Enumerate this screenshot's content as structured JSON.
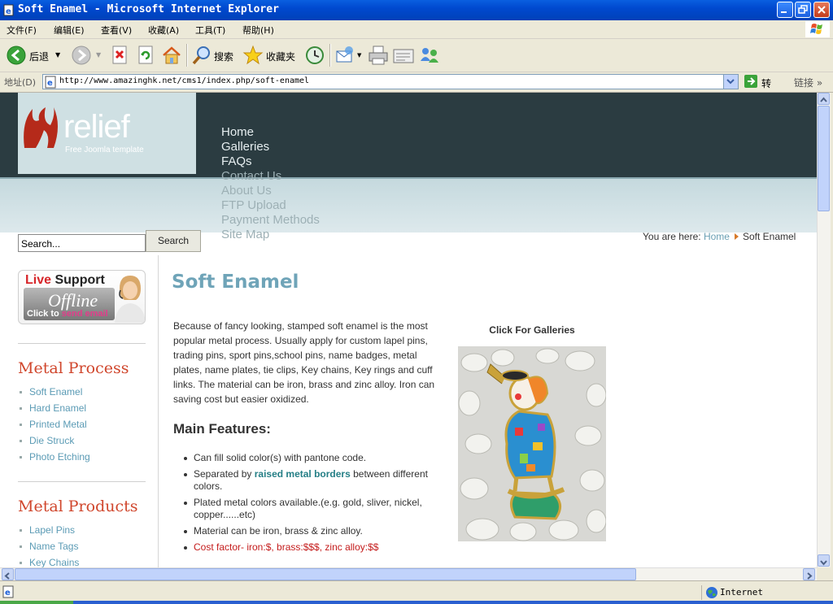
{
  "window": {
    "title": "Soft Enamel - Microsoft Internet Explorer"
  },
  "menu": [
    "文件(F)",
    "编辑(E)",
    "查看(V)",
    "收藏(A)",
    "工具(T)",
    "帮助(H)"
  ],
  "toolbar": {
    "back": "后退",
    "search": "搜索",
    "favorites": "收藏夹"
  },
  "address": {
    "label": "地址(D)",
    "url": "http://www.amazinghk.net/cms1/index.php/soft-enamel",
    "go": "转到",
    "links": "链接"
  },
  "status": {
    "zone": "Internet"
  },
  "page": {
    "logo": {
      "text": "relief",
      "subtitle": "Free Joomla template"
    },
    "topnav": [
      "Home",
      "Galleries",
      "FAQs",
      "Contact Us",
      "About Us",
      "FTP Upload",
      "Payment Methods",
      "Site Map"
    ],
    "search": {
      "value": "Search...",
      "button": "Search"
    },
    "breadcrumb": {
      "prefix": "You are here:",
      "home": "Home",
      "current": "Soft Enamel"
    },
    "live_support": {
      "live": "Live",
      "support": "Support",
      "offline": "Offline",
      "click_to": "Click to",
      "send_email": "send email"
    },
    "sidebar": {
      "metal_process": {
        "heading": "Metal Process",
        "items": [
          "Soft Enamel",
          "Hard Enamel",
          "Printed Metal",
          "Die Struck",
          "Photo Etching"
        ]
      },
      "metal_products": {
        "heading": "Metal Products",
        "items": [
          "Lapel Pins",
          "Name Tags",
          "Key Chains"
        ]
      }
    },
    "title": "Soft Enamel",
    "intro": "Because of fancy looking, stamped soft enamel is the most popular metal process. Usually apply for custom lapel pins, trading pins, sport pins,school pins, name badges, metal plates, name plates, tie clips, Key chains, Key rings and cuff links. The material can be iron, brass and zinc alloy. Iron can saving cost but easier oxidized.",
    "features_heading": "Main Features:",
    "features": {
      "f1": "Can fill solid color(s) with pantone code.",
      "f2_pre": "Separated by ",
      "f2_hl": "raised metal borders",
      "f2_post": " between different colors.",
      "f3": "Plated metal colors available.(e.g. gold, sliver, nickel, copper......etc)",
      "f4": "Material can be iron, brass & zinc alloy.",
      "f5": "Cost factor- iron:$, brass:$$$, zinc alloy:$$"
    },
    "gallery_label": "Click For Galleries"
  },
  "colors": {
    "title_bar": "#0049cf",
    "header_dark": "#2b3c41",
    "accent_heading": "#d0462c",
    "link": "#5b9bb5",
    "page_title": "#6fa4b8",
    "cost_red": "#c41b1b"
  }
}
